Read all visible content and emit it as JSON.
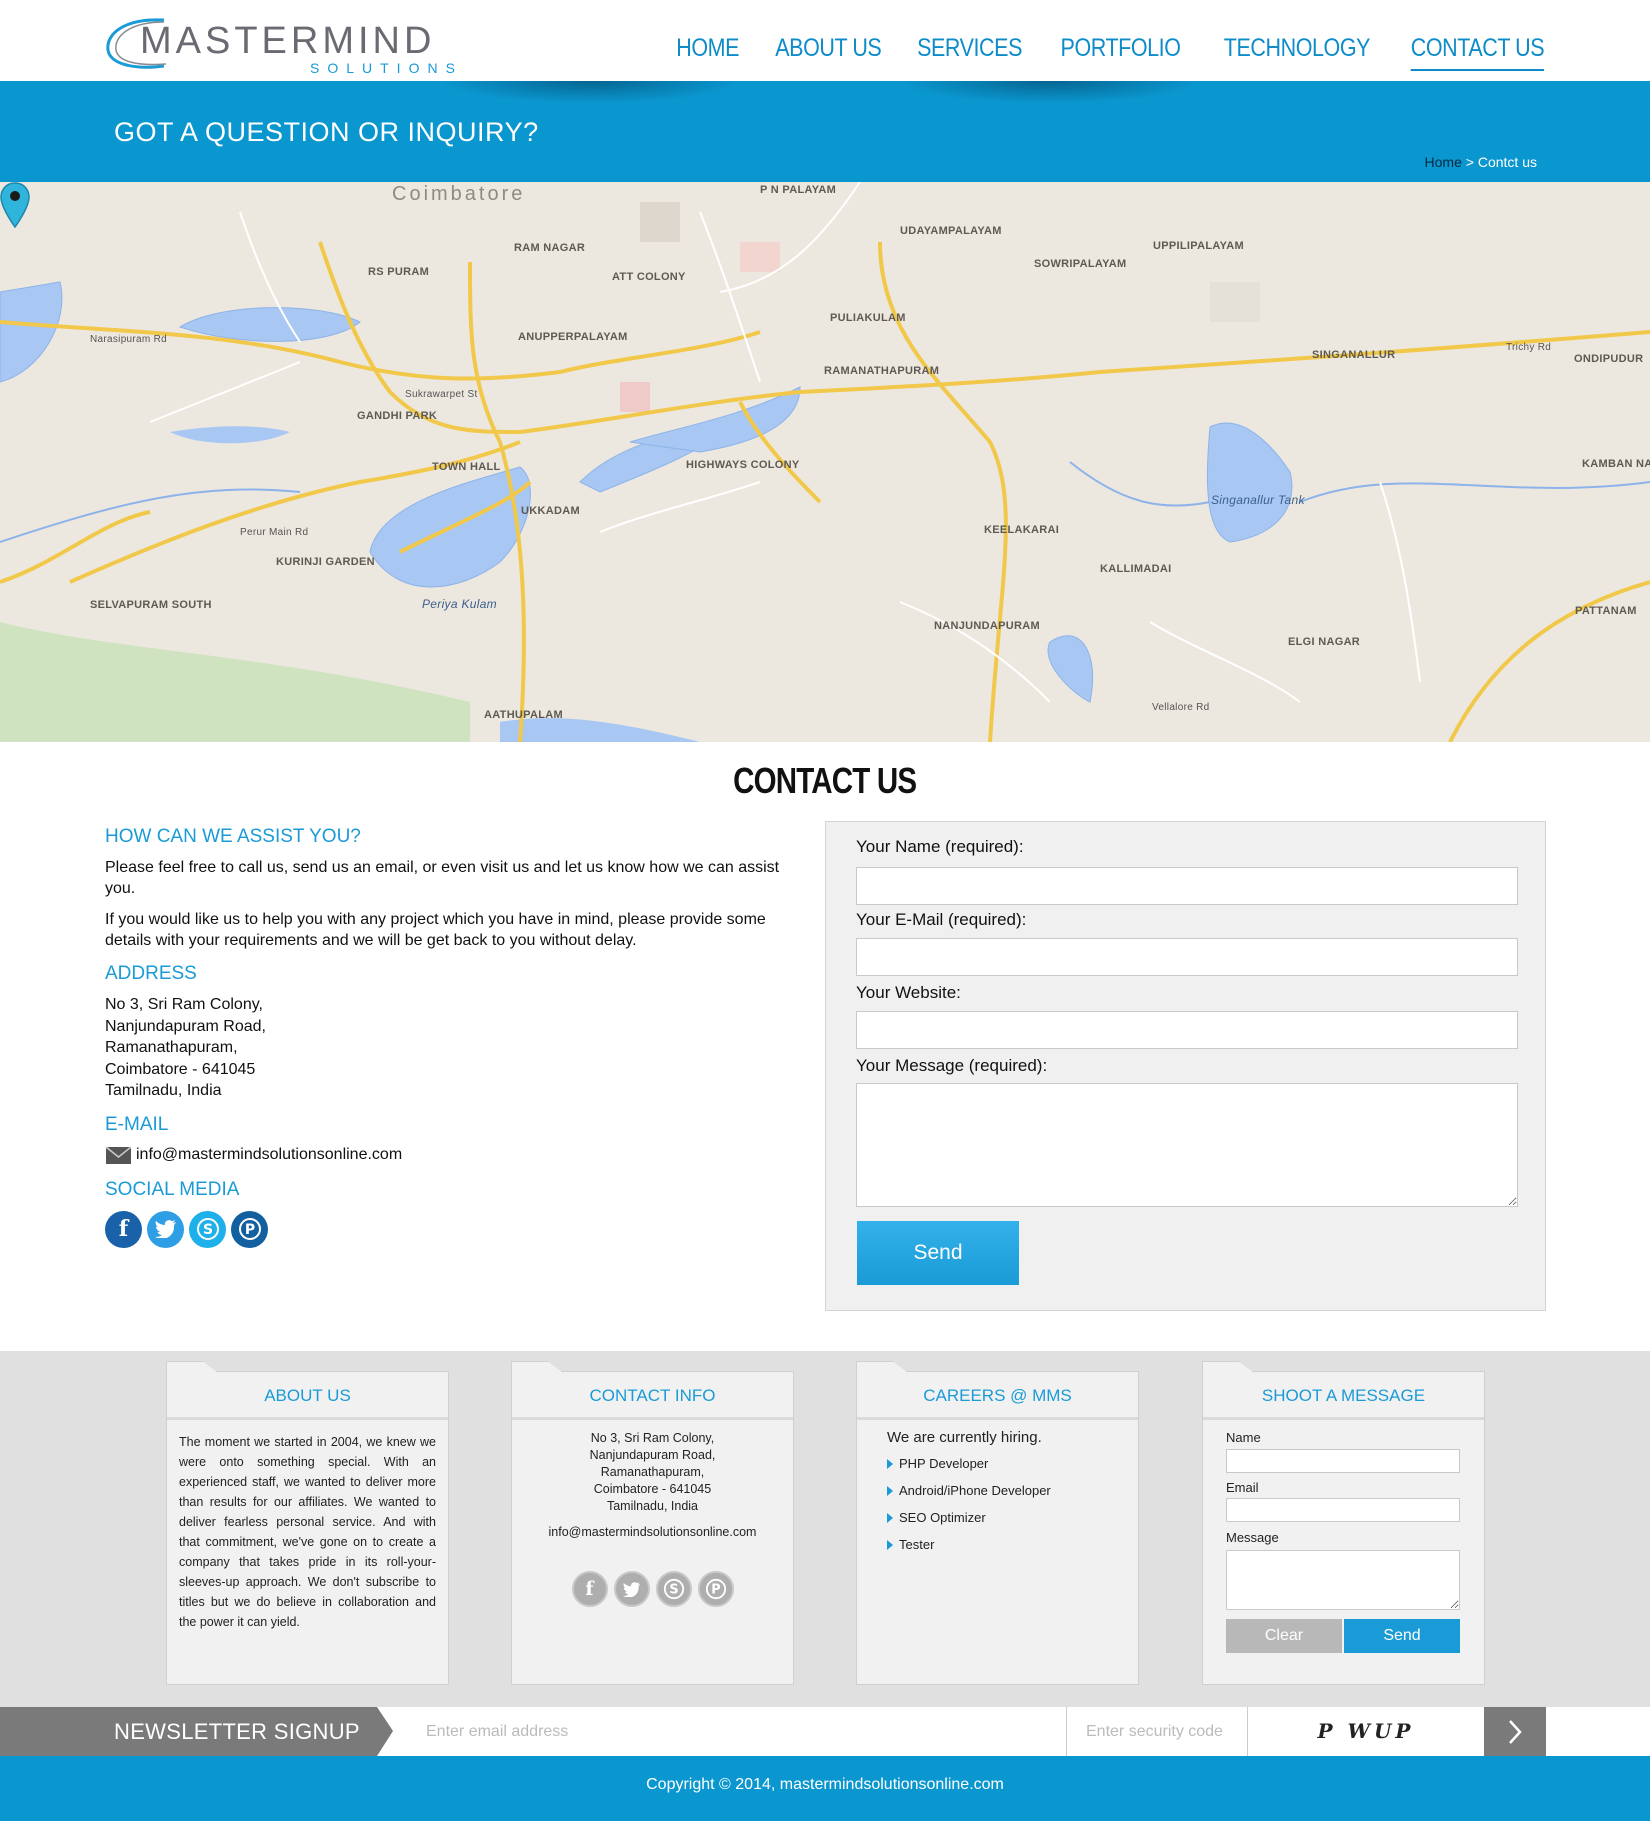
{
  "logo": {
    "main": "MASTERMIND",
    "sub": "SOLUTIONS"
  },
  "nav": [
    {
      "label": "HOME"
    },
    {
      "label": "ABOUT US"
    },
    {
      "label": "SERVICES"
    },
    {
      "label": "PORTFOLIO"
    },
    {
      "label": "TECHNOLOGY"
    },
    {
      "label": "CONTACT US",
      "active": true
    }
  ],
  "banner": {
    "title": "GOT A QUESTION OR INQUIRY?",
    "crumb_home": "Home",
    "crumb_sep": " > ",
    "crumb_current": "Contct us"
  },
  "map": {
    "pin_icon": "map-pin-icon",
    "labels": {
      "coimbatore": "Coimbatore",
      "ramanathapuram": "RAMANATHAPURAM",
      "singanallur": "SINGANALLUR",
      "singanallur_tank": "Singanallur Tank",
      "periya_kulam": "Periya Kulam",
      "ukkadam": "UKKADAM",
      "town_hall": "TOWN HALL",
      "rs_puram": "RS PURAM",
      "ram_nagar": "RAM NAGAR",
      "gandhi_park": "GANDHI PARK",
      "udayampalayam": "UDAYAMPALAYAM",
      "sowripalayam": "SOWRIPALAYAM",
      "puliakulam": "PULIAKULAM",
      "kallimadai": "KALLIMADAI",
      "highways_colony": "HIGHWAYS COLONY",
      "anupperpalayam": "ANUPPERPALAYAM",
      "selvapuram_south": "SELVAPURAM SOUTH",
      "kurinji_garden": "KURINJI GARDEN",
      "nanjundapuram": "NANJUNDAPURAM",
      "keelakarai": "KEELAKARAI",
      "att_colony": "ATT COLONY",
      "pn_palayam": "P N PALAYAM",
      "uppilipalayam": "UPPILIPALAYAM",
      "ondipudur": "ONDIPUDUR",
      "pattanam": "PATTANAM",
      "kamban_nagar": "KAMBAN NAGAR",
      "elgi_nagar": "ELGI NAGAR",
      "aathupalam": "AATHUPALAM",
      "trichy_rd": "Trichy Rd",
      "perur_main_rd": "Perur Main Rd",
      "narasipuram_rd": "Narasipuram Rd",
      "sukrawarpet_st": "Sukrawarpet St",
      "vellalore_rd": "Vellalore Rd"
    }
  },
  "page_heading": "CONTACT US",
  "assist": {
    "title": "HOW CAN WE ASSIST YOU?",
    "p1": "Please feel free to call us, send us an email, or even visit us and let us know how we can assist you.",
    "p2": "If you would like us to help you with any project which you have in mind, please provide some details with your requirements and we will be get back to you without delay."
  },
  "address": {
    "title": "ADDRESS",
    "lines": [
      "No 3, Sri Ram Colony,",
      "Nanjundapuram Road,",
      "Ramanathapuram,",
      "Coimbatore - 641045",
      "Tamilnadu, India"
    ]
  },
  "email": {
    "title": "E-MAIL",
    "icon": "envelope-icon",
    "value": "info@mastermindsolutionsonline.com"
  },
  "social": {
    "title": "SOCIAL MEDIA",
    "icons": [
      "facebook-icon",
      "twitter-icon",
      "skype-icon",
      "pinterest-icon"
    ]
  },
  "contact_form": {
    "name_label": "Your Name (required):",
    "email_label": "Your E-Mail (required):",
    "website_label": "Your Website:",
    "message_label": "Your Message (required):",
    "send_label": "Send"
  },
  "footer": {
    "about": {
      "title": "ABOUT US",
      "text": "The moment we started in 2004, we knew we were onto something special. With an experienced staff, we wanted to deliver more than results for our affiliates. We wanted to deliver fearless personal service. And with that commitment, we've gone on to create a company that takes pride in its roll-your-sleeves-up approach. We don't subscribe to titles but we do believe in collaboration and the power it can yield."
    },
    "contact": {
      "title": "CONTACT INFO",
      "lines": [
        "No 3, Sri Ram Colony,",
        "Nanjundapuram Road,",
        "Ramanathapuram,",
        "Coimbatore - 641045",
        "Tamilnadu, India"
      ],
      "email": "info@mastermindsolutionsonline.com"
    },
    "careers": {
      "title": "CAREERS @ MMS",
      "intro": "We are currently hiring.",
      "jobs": [
        "PHP Developer",
        "Android/iPhone Developer",
        "SEO Optimizer",
        "Tester"
      ]
    },
    "message": {
      "title": "SHOOT A MESSAGE",
      "name_label": "Name",
      "email_label": "Email",
      "message_label": "Message",
      "clear_label": "Clear",
      "send_label": "Send"
    }
  },
  "newsletter": {
    "label": "NEWSLETTER SIGNUP",
    "email_placeholder": "Enter email address",
    "security_placeholder": "Enter security code",
    "captcha": "P WUP",
    "go_icon": "chevron-right-icon"
  },
  "copyright": "Copyright © 2014, mastermindsolutionsonline.com",
  "colors": {
    "brand_blue": "#0a96ce",
    "link_blue": "#1a9bd7",
    "gray": "#7a7a7a"
  }
}
